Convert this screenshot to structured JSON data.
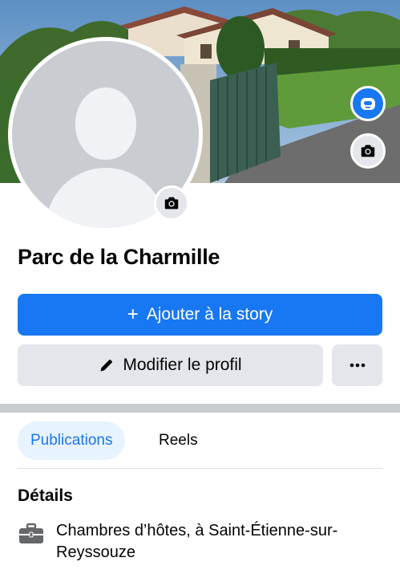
{
  "profile": {
    "name": "Parc de la Charmille"
  },
  "actions": {
    "add_story_label": "Ajouter à la story",
    "add_story_icon": "plus-icon",
    "edit_profile_label": "Modifier le profil",
    "edit_profile_icon": "pencil-icon",
    "more_icon": "more-dots-icon"
  },
  "cover": {
    "avatar_button_icon": "avatar-icon",
    "camera_button_icon": "camera-icon"
  },
  "tabs": [
    {
      "label": "Publications",
      "active": true
    },
    {
      "label": "Reels",
      "active": false
    }
  ],
  "details": {
    "title": "Détails",
    "items": [
      {
        "icon": "briefcase-icon",
        "text": "Chambres d’hôtes, à Saint-Étienne-sur-Reyssouze"
      }
    ]
  },
  "colors": {
    "accent": "#1877f2",
    "button_grey": "#e4e6eb",
    "tab_active_bg": "#e7f3ff"
  }
}
